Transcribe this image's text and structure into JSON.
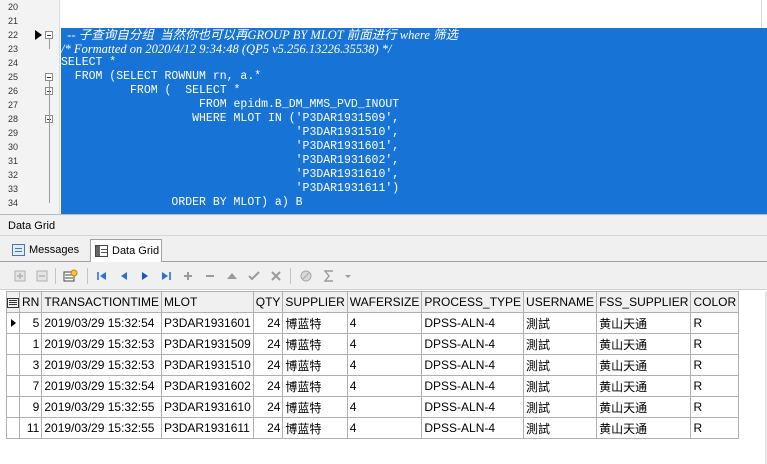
{
  "editor": {
    "lines": [
      {
        "num": "20",
        "text": ""
      },
      {
        "num": "21",
        "text": ""
      },
      {
        "num": "22",
        "text": "  -- 子查询自分组  当然你也可以再GROUP BY MLOT 前面进行 where 筛选",
        "italic": true
      },
      {
        "num": "23",
        "text": "/* Formatted on 2020/4/12 9:34:48 (QP5 v5.256.13226.35538) */",
        "italic": true
      },
      {
        "num": "24",
        "text": "SELECT *"
      },
      {
        "num": "25",
        "text": "  FROM (SELECT ROWNUM rn, a.*"
      },
      {
        "num": "26",
        "text": "          FROM (  SELECT *"
      },
      {
        "num": "27",
        "text": "                    FROM epidm.B_DM_MMS_PVD_INOUT"
      },
      {
        "num": "28",
        "text": "                   WHERE MLOT IN ('P3DAR1931509',"
      },
      {
        "num": "29",
        "text": "                                  'P3DAR1931510',"
      },
      {
        "num": "30",
        "text": "                                  'P3DAR1931601',"
      },
      {
        "num": "31",
        "text": "                                  'P3DAR1931602',"
      },
      {
        "num": "32",
        "text": "                                  'P3DAR1931610',"
      },
      {
        "num": "33",
        "text": "                                  'P3DAR1931611')"
      },
      {
        "num": "34",
        "text": "                ORDER BY MLOT) a) B"
      }
    ]
  },
  "panel": {
    "title": "Data Grid",
    "tabs": [
      "Messages",
      "Data Grid"
    ]
  },
  "grid": {
    "columns": [
      "RN",
      "TRANSACTIONTIME",
      "MLOT",
      "QTY",
      "SUPPLIER",
      "WAFERSIZE",
      "PROCESS_TYPE",
      "USERNAME",
      "FSS_SUPPLIER",
      "COLOR"
    ],
    "rows": [
      [
        "5",
        "2019/03/29 15:32:54",
        "P3DAR1931601",
        "24",
        "博蓝特",
        "4",
        "DPSS-ALN-4",
        "測試",
        "黄山天通",
        "R"
      ],
      [
        "1",
        "2019/03/29 15:32:53",
        "P3DAR1931509",
        "24",
        "博蓝特",
        "4",
        "DPSS-ALN-4",
        "測試",
        "黄山天通",
        "R"
      ],
      [
        "3",
        "2019/03/29 15:32:53",
        "P3DAR1931510",
        "24",
        "博蓝特",
        "4",
        "DPSS-ALN-4",
        "測試",
        "黄山天通",
        "R"
      ],
      [
        "7",
        "2019/03/29 15:32:54",
        "P3DAR1931602",
        "24",
        "博蓝特",
        "4",
        "DPSS-ALN-4",
        "測試",
        "黄山天通",
        "R"
      ],
      [
        "9",
        "2019/03/29 15:32:55",
        "P3DAR1931610",
        "24",
        "博蓝特",
        "4",
        "DPSS-ALN-4",
        "測試",
        "黄山天通",
        "R"
      ],
      [
        "11",
        "2019/03/29 15:32:55",
        "P3DAR1931611",
        "24",
        "博蓝特",
        "4",
        "DPSS-ALN-4",
        "測試",
        "黄山天通",
        "R"
      ]
    ]
  },
  "icons": {
    "toolbar": [
      "insert-row-icon",
      "delete-row-icon",
      "refresh-icon",
      "first-record-icon",
      "prev-record-icon",
      "next-record-icon",
      "last-record-icon",
      "add-icon",
      "remove-icon",
      "move-up-icon",
      "post-icon",
      "cancel-icon",
      "filter-icon",
      "sum-icon",
      "dropdown-icon"
    ]
  },
  "colors": {
    "selection": "#1873d6",
    "accent": "#1c6ed6"
  }
}
